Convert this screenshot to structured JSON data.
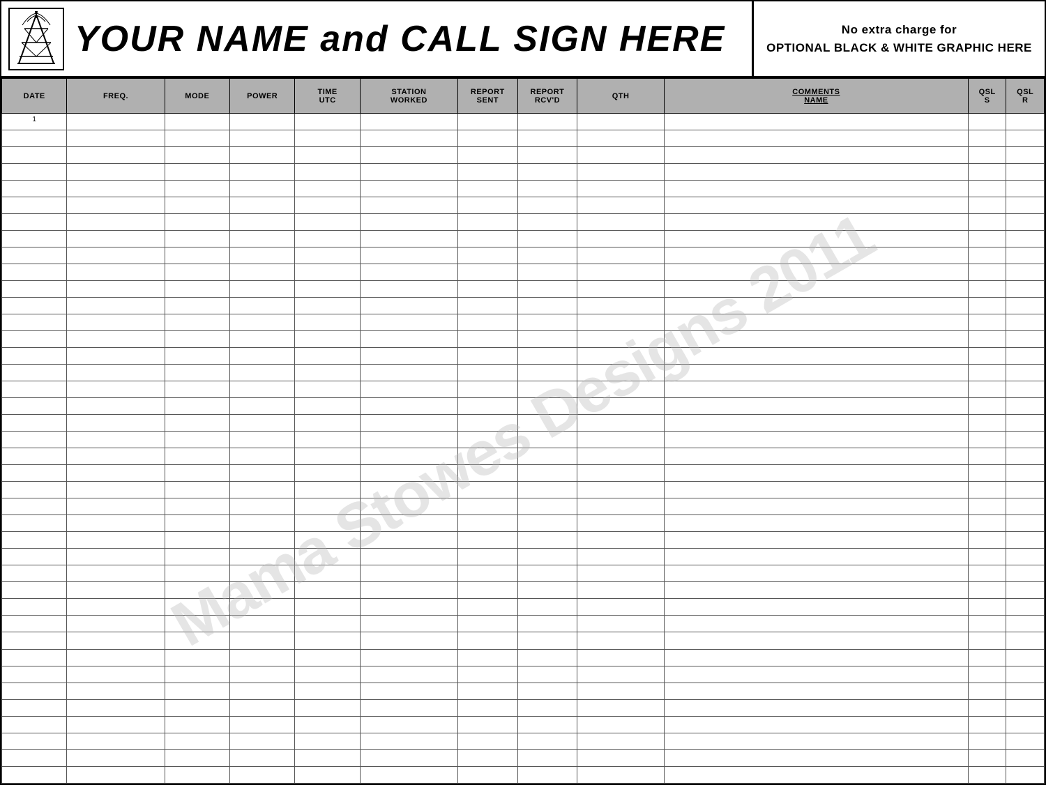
{
  "header": {
    "title": "YOUR NAME and CALL SIGN HERE",
    "optional_line1": "No  extra  charge  for",
    "optional_line2": "OPTIONAL BLACK & WHITE GRAPHIC HERE"
  },
  "columns": [
    {
      "id": "date",
      "label": "DATE",
      "sub": ""
    },
    {
      "id": "freq",
      "label": "FREQ.",
      "sub": ""
    },
    {
      "id": "mode",
      "label": "MODE",
      "sub": ""
    },
    {
      "id": "power",
      "label": "POWER",
      "sub": ""
    },
    {
      "id": "time",
      "label": "TIME",
      "sub": "UTC"
    },
    {
      "id": "station",
      "label": "STATION",
      "sub": "WORKED"
    },
    {
      "id": "rsent",
      "label": "REPORT",
      "sub": "SENT"
    },
    {
      "id": "rrcvd",
      "label": "REPORT",
      "sub": "RCV'D"
    },
    {
      "id": "qth",
      "label": "QTH",
      "sub": ""
    },
    {
      "id": "comments",
      "label": "COMMENTS",
      "sub": "NAME",
      "underline": true
    },
    {
      "id": "qsls",
      "label": "QSL",
      "sub": "S"
    },
    {
      "id": "qslr",
      "label": "QSL",
      "sub": "R"
    }
  ],
  "watermark": "Mama Stowes Designs 2011",
  "row_count": 40
}
